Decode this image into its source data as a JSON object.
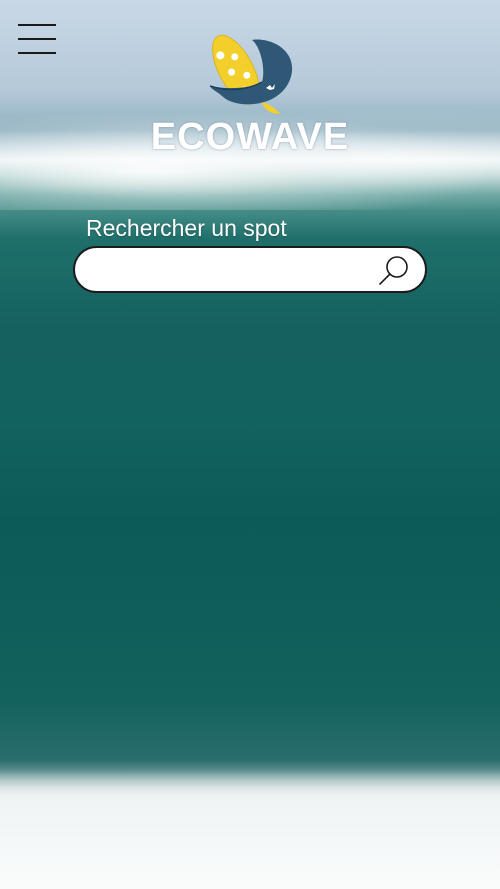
{
  "app": {
    "brand_name": "ECOWAVE"
  },
  "header": {
    "menu_icon": "hamburger-menu-icon",
    "logo_icon": "surf-cap-logo-icon"
  },
  "search": {
    "label": "Rechercher un spot",
    "value": "",
    "placeholder": "",
    "icon": "search-icon"
  },
  "colors": {
    "logo_blue": "#2f5877",
    "logo_yellow": "#f3cf2b",
    "text_white": "#ffffff",
    "border_dark": "#1b1b1b"
  }
}
